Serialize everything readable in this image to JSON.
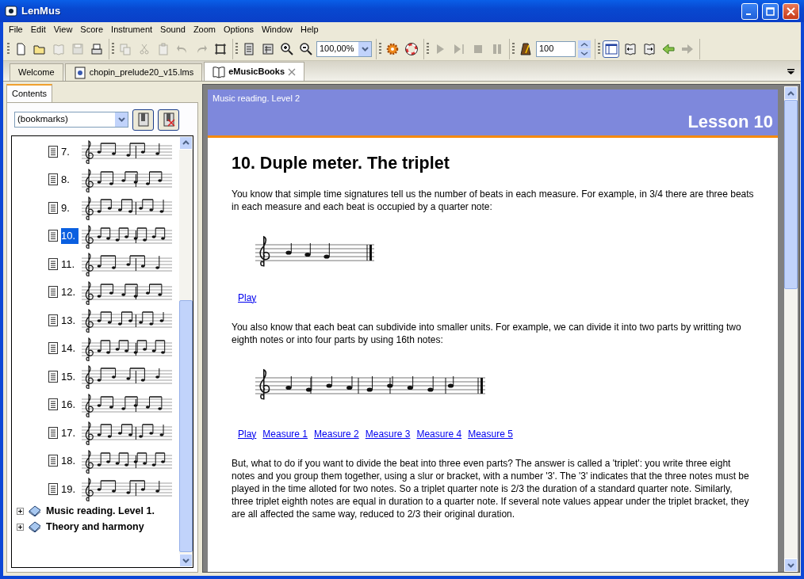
{
  "window": {
    "title": "LenMus"
  },
  "menu": [
    "File",
    "Edit",
    "View",
    "Score",
    "Instrument",
    "Sound",
    "Zoom",
    "Options",
    "Window",
    "Help"
  ],
  "toolbar": {
    "groups": [
      [
        {
          "kind": "new",
          "disabled": false
        },
        {
          "kind": "open",
          "disabled": false
        },
        {
          "kind": "book",
          "disabled": true
        },
        {
          "kind": "save",
          "disabled": true
        },
        {
          "kind": "print",
          "disabled": false
        }
      ],
      [
        {
          "kind": "copy",
          "disabled": true
        },
        {
          "kind": "cut",
          "disabled": true
        },
        {
          "kind": "paste",
          "disabled": true
        },
        {
          "kind": "undo",
          "disabled": true
        },
        {
          "kind": "redo",
          "disabled": true
        },
        {
          "kind": "frame",
          "disabled": false
        }
      ],
      [
        {
          "kind": "page",
          "disabled": false
        },
        {
          "kind": "page2",
          "disabled": false
        },
        {
          "kind": "zoomin",
          "disabled": false
        },
        {
          "kind": "zoomout",
          "disabled": false
        },
        {
          "kind": "zoomfield",
          "value": "100,00%"
        }
      ],
      [
        {
          "kind": "gear",
          "disabled": false
        },
        {
          "kind": "lifebuoy",
          "disabled": false
        }
      ],
      [
        {
          "kind": "play",
          "disabled": true
        },
        {
          "kind": "playfrom",
          "disabled": true
        },
        {
          "kind": "stop",
          "disabled": true
        },
        {
          "kind": "pause",
          "disabled": true
        }
      ],
      [
        {
          "kind": "metronome",
          "disabled": false
        },
        {
          "kind": "spinfield",
          "value": "100"
        }
      ],
      [
        {
          "kind": "panel",
          "disabled": false,
          "pressed": true
        },
        {
          "kind": "bookprev",
          "disabled": false
        },
        {
          "kind": "booknext",
          "disabled": false
        },
        {
          "kind": "back",
          "disabled": false
        },
        {
          "kind": "forward",
          "disabled": true
        }
      ]
    ]
  },
  "tabs": [
    {
      "label": "Welcome",
      "selected": false,
      "kind": "plain"
    },
    {
      "label": "chopin_prelude20_v15.lms",
      "selected": false,
      "kind": "score"
    },
    {
      "label": "eMusicBooks",
      "selected": true,
      "kind": "book"
    }
  ],
  "sidebar": {
    "tab": "Contents",
    "bookmarks": "(bookmarks)",
    "items": [
      {
        "label": "7.",
        "selected": false
      },
      {
        "label": "8.",
        "selected": false
      },
      {
        "label": "9.",
        "selected": false
      },
      {
        "label": "10.",
        "selected": true
      },
      {
        "label": "11.",
        "selected": false
      },
      {
        "label": "12.",
        "selected": false
      },
      {
        "label": "13.",
        "selected": false
      },
      {
        "label": "14.",
        "selected": false
      },
      {
        "label": "15.",
        "selected": false
      },
      {
        "label": "16.",
        "selected": false
      },
      {
        "label": "17.",
        "selected": false
      },
      {
        "label": "18.",
        "selected": false
      },
      {
        "label": "19.",
        "selected": false
      }
    ],
    "books": [
      {
        "label": "Music reading. Level 1.",
        "expanded": false
      },
      {
        "label": "Theory and harmony",
        "expanded": false
      }
    ]
  },
  "page": {
    "header_subtitle": "Music reading. Level 2",
    "header_title": "Lesson 10",
    "heading": "10. Duple meter. The triplet",
    "blocks": [
      {
        "kind": "paragraph",
        "text": "You know that simple time signatures tell us the number of beats in each measure. For example, in 3/4 there are three beats in each measure and each beat is occupied by a quarter note:"
      },
      {
        "kind": "score"
      },
      {
        "kind": "links",
        "links": [
          "Play"
        ]
      },
      {
        "kind": "paragraph",
        "text": "You also know that each beat can subdivide into smaller units. For example, we can divide it into two parts by writting two eighth notes or into four parts by using 16th notes:"
      },
      {
        "kind": "score"
      },
      {
        "kind": "links",
        "links": [
          "Play",
          "Measure 1",
          "Measure 2",
          "Measure 3",
          "Measure 4",
          "Measure 5"
        ]
      },
      {
        "kind": "paragraph",
        "text": "But, what to do if you want to divide the beat into three even parts? The answer is called a 'triplet': you write three eight notes and you group them together, using a slur or bracket, with a number '3'. The '3' indicates that the three notes must be played in the time alloted for two notes. So a triplet quarter note is 2/3 the duration of a standard quarter note. Similarly, three triplet eighth notes are equal in duration to a quarter note. If several note values appear under the triplet bracket, they are all affected the same way, reduced to 2/3 their original duration."
      }
    ]
  }
}
